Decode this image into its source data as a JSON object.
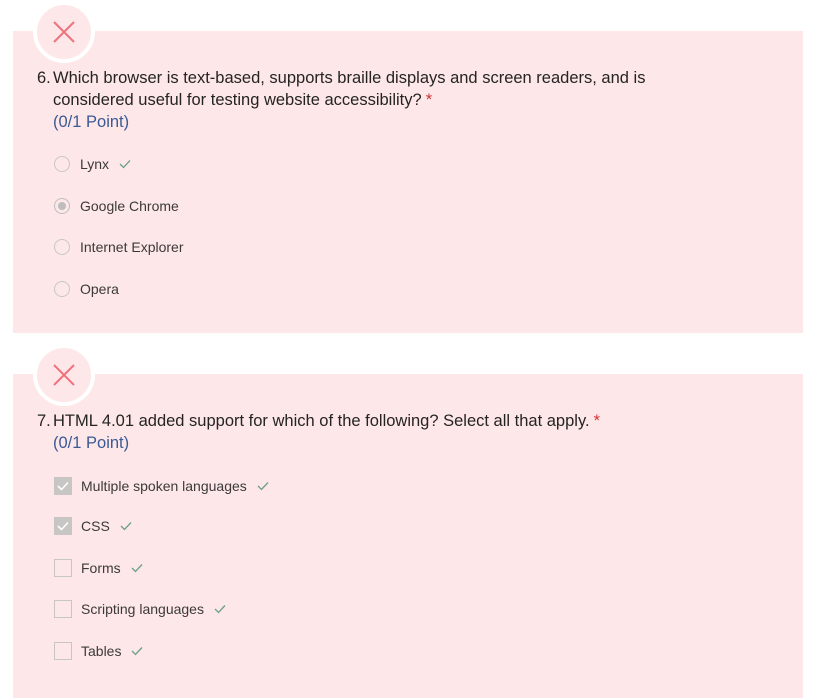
{
  "questions": [
    {
      "number": "6.",
      "text_line1": "Which browser is text-based, supports braille displays and screen readers, and is",
      "text_line2": "considered useful for testing website accessibility?",
      "required_marker": "*",
      "points": "(0/1 Point)",
      "status_icon": "x-icon",
      "type": "radio",
      "options": [
        {
          "label": "Lynx",
          "selected": false,
          "correct": true
        },
        {
          "label": "Google Chrome",
          "selected": true,
          "correct": false
        },
        {
          "label": "Internet Explorer",
          "selected": false,
          "correct": false
        },
        {
          "label": "Opera",
          "selected": false,
          "correct": false
        }
      ]
    },
    {
      "number": "7.",
      "text_line1": "HTML 4.01 added support for which of the following? Select all that apply.",
      "required_marker": "*",
      "points": "(0/1 Point)",
      "status_icon": "x-icon",
      "type": "checkbox",
      "options": [
        {
          "label": "Multiple spoken languages",
          "selected": true,
          "correct": true
        },
        {
          "label": "CSS",
          "selected": true,
          "correct": true
        },
        {
          "label": "Forms",
          "selected": false,
          "correct": true
        },
        {
          "label": "Scripting languages",
          "selected": false,
          "correct": true
        },
        {
          "label": "Tables",
          "selected": false,
          "correct": true
        }
      ]
    }
  ],
  "colors": {
    "card_background": "#fde7e9",
    "incorrect_icon": "#f1707b",
    "required": "#d13438",
    "points": "#3a5a95",
    "correct_check": "#6b9e8a"
  }
}
